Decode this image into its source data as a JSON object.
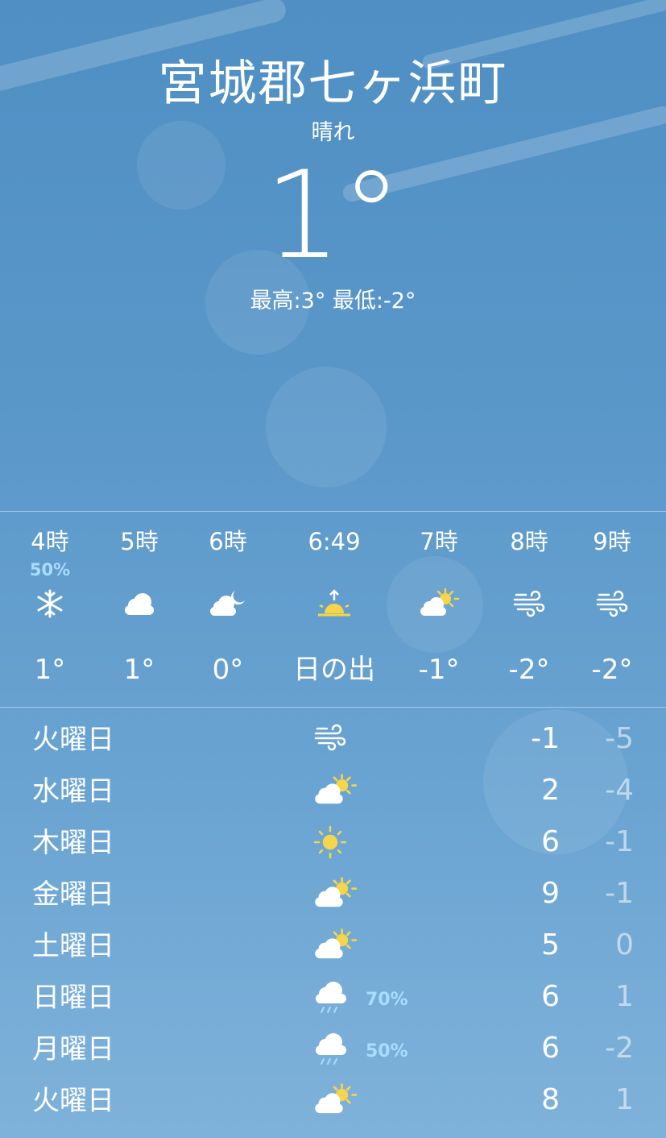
{
  "location": "宮城郡七ヶ浜町",
  "condition": "晴れ",
  "current_temp": "1°",
  "hilo": "最高:3° 最低:-2°",
  "hourly": [
    {
      "time": "4時",
      "pop": "50%",
      "icon": "snowflake-icon",
      "temp": "1°"
    },
    {
      "time": "5時",
      "pop": "",
      "icon": "cloud-icon",
      "temp": "1°"
    },
    {
      "time": "6時",
      "pop": "",
      "icon": "cloud-moon-icon",
      "temp": "0°"
    },
    {
      "time": "6:49",
      "pop": "",
      "icon": "sunrise-icon",
      "temp": "日の出"
    },
    {
      "time": "7時",
      "pop": "",
      "icon": "partly-sunny-icon",
      "temp": "-1°"
    },
    {
      "time": "8時",
      "pop": "",
      "icon": "wind-icon",
      "temp": "-2°"
    },
    {
      "time": "9時",
      "pop": "",
      "icon": "wind-icon",
      "temp": "-2°"
    }
  ],
  "daily": [
    {
      "day": "火曜日",
      "icon": "wind-icon",
      "pop": "",
      "high": "-1",
      "low": "-5"
    },
    {
      "day": "水曜日",
      "icon": "partly-sunny-icon",
      "pop": "",
      "high": "2",
      "low": "-4"
    },
    {
      "day": "木曜日",
      "icon": "sun-icon",
      "pop": "",
      "high": "6",
      "low": "-1"
    },
    {
      "day": "金曜日",
      "icon": "partly-sunny-icon",
      "pop": "",
      "high": "9",
      "low": "-1"
    },
    {
      "day": "土曜日",
      "icon": "partly-sunny-icon",
      "pop": "",
      "high": "5",
      "low": "0"
    },
    {
      "day": "日曜日",
      "icon": "rain-icon",
      "pop": "70%",
      "high": "6",
      "low": "1"
    },
    {
      "day": "月曜日",
      "icon": "rain-icon",
      "pop": "50%",
      "high": "6",
      "low": "-2"
    },
    {
      "day": "火曜日",
      "icon": "partly-sunny-icon",
      "pop": "",
      "high": "8",
      "low": "1"
    }
  ],
  "colors": {
    "sun": "#f7d54a",
    "precip": "#a9dcff",
    "sky": "#5a97c9"
  }
}
